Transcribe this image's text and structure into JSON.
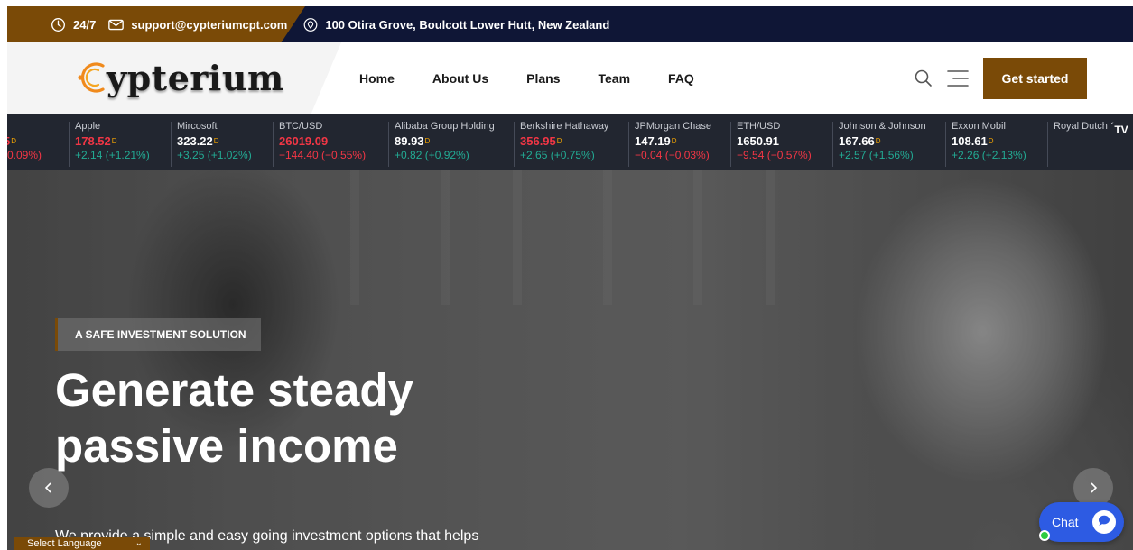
{
  "topbar": {
    "hours_icon": "clock-icon",
    "hours": "24/7",
    "email_icon": "mail-icon",
    "email": "support@cypteriumcpt.com",
    "address_icon": "location-pin-icon",
    "address": "100 Otira Grove, Boulcott Lower Hutt, New Zealand"
  },
  "header": {
    "logo_text": "ypterium",
    "nav": [
      "Home",
      "About Us",
      "Plans",
      "Team",
      "FAQ"
    ],
    "search_icon": "search-icon",
    "menu_icon": "menu-icon",
    "cta": "Get started"
  },
  "ticker": [
    {
      "name": "t",
      "price": "5",
      "delayed": "D",
      "change": "-0.09%)",
      "price_color": "red",
      "change_color": "red"
    },
    {
      "name": "Apple",
      "price": "178.52",
      "delayed": "D",
      "change": "+2.14 (+1.21%)",
      "price_color": "red",
      "change_color": "green"
    },
    {
      "name": "Mircosoft",
      "price": "323.22",
      "delayed": "D",
      "change": "+3.25 (+1.02%)",
      "price_color": "white",
      "change_color": "green"
    },
    {
      "name": "BTC/USD",
      "price": "26019.09",
      "delayed": "",
      "change": "−144.40 (−0.55%)",
      "price_color": "red",
      "change_color": "red"
    },
    {
      "name": "Alibaba Group Holding",
      "price": "89.93",
      "delayed": "D",
      "change": "+0.82 (+0.92%)",
      "price_color": "white",
      "change_color": "green"
    },
    {
      "name": "Berkshire Hathaway",
      "price": "356.95",
      "delayed": "D",
      "change": "+2.65 (+0.75%)",
      "price_color": "red",
      "change_color": "green"
    },
    {
      "name": "JPMorgan Chase",
      "price": "147.19",
      "delayed": "D",
      "change": "−0.04 (−0.03%)",
      "price_color": "white",
      "change_color": "red"
    },
    {
      "name": "ETH/USD",
      "price": "1650.91",
      "delayed": "",
      "change": "−9.54 (−0.57%)",
      "price_color": "white",
      "change_color": "red"
    },
    {
      "name": "Johnson & Johnson",
      "price": "167.66",
      "delayed": "D",
      "change": "+2.57 (+1.56%)",
      "price_color": "white",
      "change_color": "green"
    },
    {
      "name": "Exxon Mobil",
      "price": "108.61",
      "delayed": "D",
      "change": "+2.26 (+2.13%)",
      "price_color": "white",
      "change_color": "green"
    },
    {
      "name": "Royal Dutch S",
      "price": "",
      "delayed": "",
      "change": "",
      "price_color": "white",
      "change_color": "green"
    }
  ],
  "ticker_brand": "TV",
  "hero": {
    "badge": "A SAFE INVESTMENT SOLUTION",
    "headline": "Generate steady passive income",
    "description": "We provide a simple and easy going investment options that helps",
    "prev_icon": "chevron-left-icon",
    "next_icon": "chevron-right-icon"
  },
  "language": {
    "label": "Select Language",
    "caret": "⌄"
  },
  "chat": {
    "label": "Chat",
    "icon": "chat-bubble-icon"
  },
  "colors": {
    "brand": "#7a4a07",
    "navy": "#0f1636",
    "ticker_bg": "#222630",
    "chat": "#2d5be3"
  }
}
